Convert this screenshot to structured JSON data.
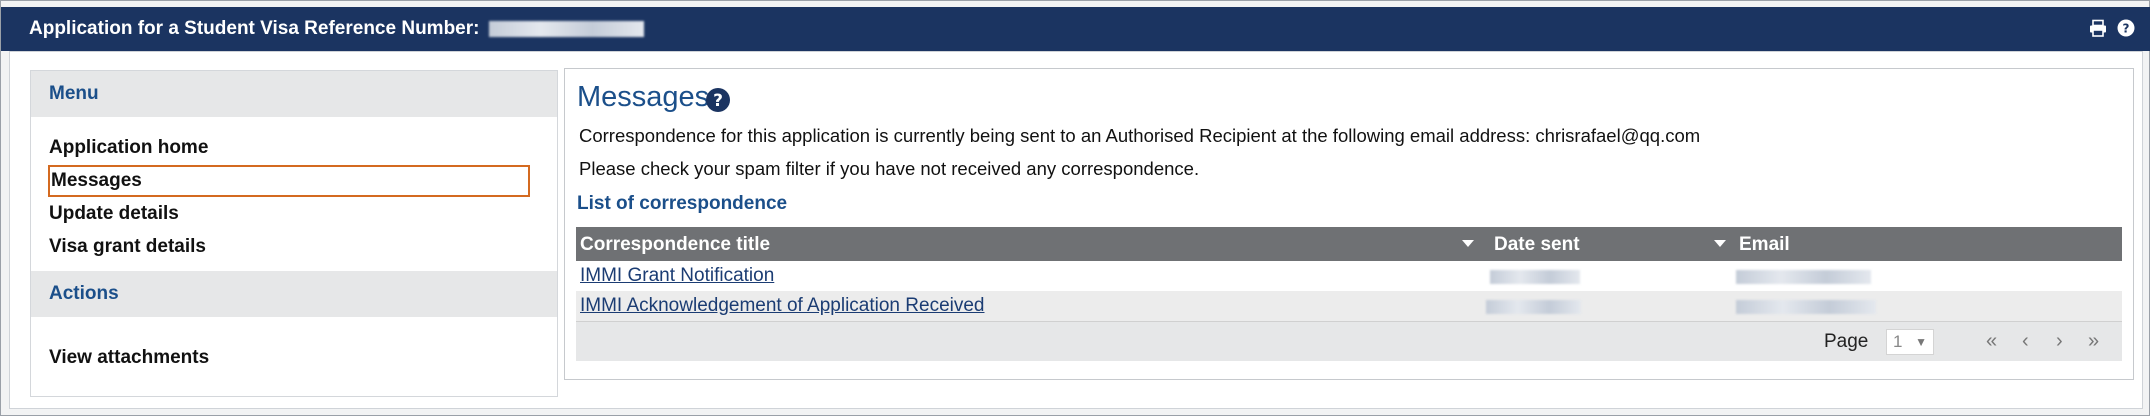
{
  "header": {
    "title": "Application for a Student Visa Reference Number:",
    "icons": [
      "print-icon",
      "help-icon"
    ]
  },
  "sidebar": {
    "menu_heading": "Menu",
    "menu_items": [
      {
        "label": "Application home"
      },
      {
        "label": "Messages",
        "active": true
      },
      {
        "label": "Update details"
      },
      {
        "label": "Visa grant details"
      }
    ],
    "actions_heading": "Actions",
    "action_items": [
      {
        "label": "View attachments"
      }
    ]
  },
  "main": {
    "title": "Messages",
    "paragraph1": "Correspondence for this application is currently being sent to an Authorised Recipient at the following email address: chrisrafael@qq.com",
    "paragraph2": "Please check your spam filter if you have not received any correspondence.",
    "list_heading": "List of correspondence",
    "table": {
      "columns": [
        "Correspondence title",
        "Date sent",
        "Email"
      ],
      "rows": [
        {
          "title": "IMMI Grant Notification"
        },
        {
          "title": "IMMI Acknowledgement of Application Received"
        }
      ]
    },
    "pagination": {
      "label": "Page",
      "current_page": "1",
      "caret": "▼",
      "first": "«",
      "prev": "‹",
      "next": "›",
      "last": "»"
    }
  },
  "colors": {
    "header_bg": "#1b3461",
    "heading_blue": "#1b4f8a",
    "table_header_bg": "#6f7174",
    "active_outline": "#d46a20"
  }
}
